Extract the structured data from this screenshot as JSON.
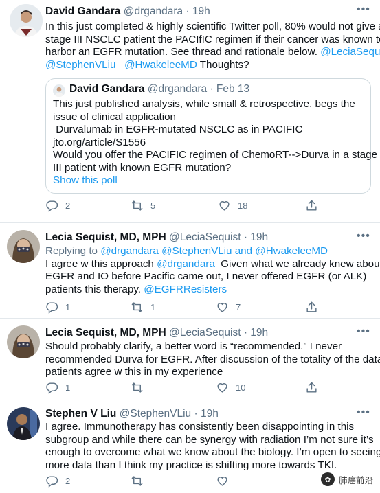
{
  "tweets": [
    {
      "name": "David Gandara",
      "handle": "@drgandara",
      "time": "· 19h",
      "lines": [
        "In this just completed & highly scientific Twitter poll, 80% would not give a",
        "stage III NSCLC patient the PACIfIC  regimen if their cancer was known to",
        "harbor an EGFR mutation. See thread and rationale below."
      ],
      "mention1": "@LeciaSequist",
      "mention2": "@StephenVLiu",
      "mention3": "@HwakeleeMD",
      "tail": "Thoughts?",
      "replies": "2",
      "retweets": "5",
      "likes": "18"
    },
    {
      "name": "Lecia Sequist, MD, MPH",
      "handle": "@LeciaSequist",
      "time": "· 19h",
      "replying_prefix": "Replying to",
      "replying_to": "@drgandara @StephenVLiu and @HwakeleeMD",
      "line1_a": "I agree w this approach",
      "line1_mention": "@drgandara",
      "line1_b": "Given what we already knew about",
      "line2": "EGFR and IO before Pacific came out, I never offered EGFR (or ALK)",
      "line3_a": "patients this therapy.",
      "line3_mention": "@EGFRResisters",
      "replies": "1",
      "retweets": "1",
      "likes": "7"
    },
    {
      "name": "Lecia Sequist, MD, MPH",
      "handle": "@LeciaSequist",
      "time": "· 19h",
      "lines": [
        "Should probably clarify, a better word is “recommended.” I never",
        "recommended Durva for EGFR. After discussion of the totality of the data,",
        "patients agree w this in my experience"
      ],
      "replies": "1",
      "retweets": "",
      "likes": "10"
    },
    {
      "name": "Stephen V Liu",
      "handle": "@StephenVLiu",
      "time": "· 19h",
      "lines": [
        "I agree. Immunotherapy has consistently been disappointing in this",
        "subgroup and while there can be synergy with radiation I’m not sure it’s",
        "enough to overcome what we know about the biology. I’m open to seeing",
        "more data than I think my practice is shifting more towards TKI."
      ],
      "replies": "2",
      "retweets": "",
      "likes": ""
    }
  ],
  "quote": {
    "name": "David Gandara",
    "handle": "@drgandara",
    "time": "· Feb 13",
    "lines": [
      "This just published analysis, while small & retrospective, begs the",
      "issue of clinical application",
      " Durvalumab in EGFR-mutated NSCLC as in PACIFIC",
      "jto.org/article/S1556",
      "Would you offer the PACIFIC regimen of ChemoRT-->Durva in a stage",
      "III patient with known EGFR mutation?"
    ],
    "show_poll": "Show this poll"
  },
  "more_icon": "more-dots-icon",
  "watermark": "肺癌前沿",
  "colors": {
    "accent": "#1d9bf0",
    "secondary": "#5b7083",
    "divider": "#e3e8ec"
  }
}
